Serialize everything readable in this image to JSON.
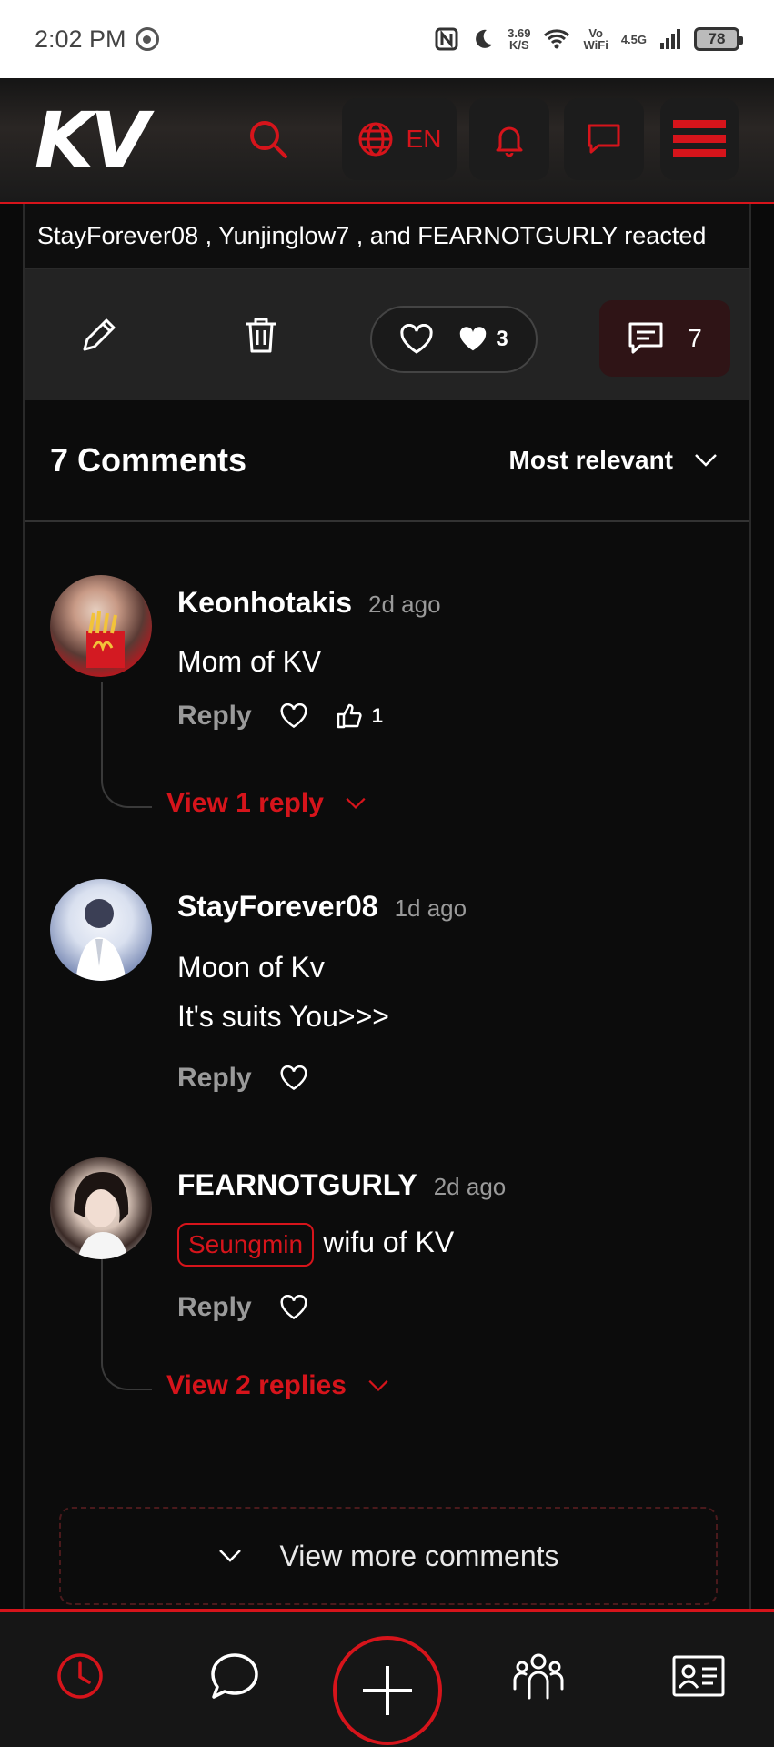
{
  "status_bar": {
    "time": "2:02 PM",
    "net_speed": "3.69",
    "net_unit": "K/S",
    "volte": "Vo",
    "wifi_label": "WiFi",
    "network": "4.5G",
    "battery": "78"
  },
  "header": {
    "logo": "KV",
    "language": "EN",
    "accent_color": "#d6141b"
  },
  "post": {
    "reacted_text": "StayForever08 , Yunjinglow7 , and FEARNOTGURLY reacted",
    "like_count": "3",
    "comment_count": "7"
  },
  "comments_section": {
    "title": "7 Comments",
    "sort_label": "Most relevant",
    "items": [
      {
        "author": "Keonhotakis",
        "time": "2d ago",
        "text": "Mom of KV",
        "reply_label": "Reply",
        "thumbs_count": "1",
        "view_replies": "View 1 reply"
      },
      {
        "author": "StayForever08",
        "time": "1d ago",
        "text_line1": "Moon of Kv",
        "text_line2": "It's suits You>>>",
        "reply_label": "Reply"
      },
      {
        "author": "FEARNOTGURLY",
        "time": "2d ago",
        "tag": "Seungmin",
        "text": "wifu of KV",
        "reply_label": "Reply",
        "view_replies": "View 2 replies"
      }
    ],
    "view_more": "View more comments"
  },
  "bottom_nav": {
    "items": [
      "clock-icon",
      "chat-bubble-icon",
      "plus-icon",
      "community-icon",
      "profile-card-icon"
    ]
  }
}
